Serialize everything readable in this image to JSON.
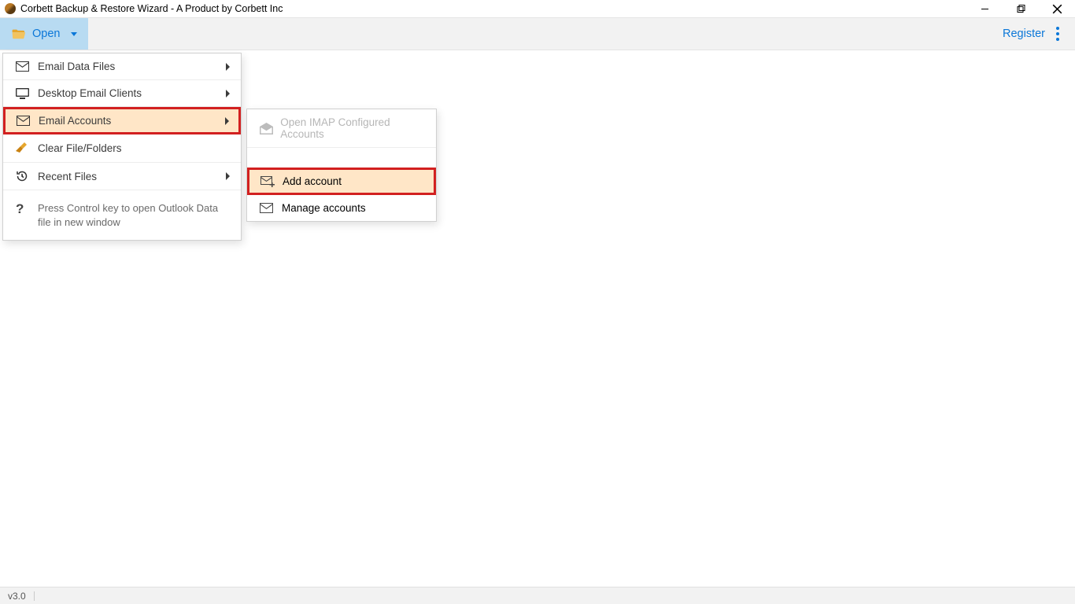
{
  "window": {
    "title": "Corbett Backup & Restore Wizard - A Product by Corbett Inc"
  },
  "toolbar": {
    "open_label": "Open",
    "register_label": "Register"
  },
  "menu": {
    "items": [
      {
        "label": "Email Data Files",
        "has_sub": true,
        "icon": "mail"
      },
      {
        "label": "Desktop Email Clients",
        "has_sub": true,
        "icon": "monitor"
      },
      {
        "label": "Email Accounts",
        "has_sub": true,
        "icon": "mail",
        "highlight": true
      },
      {
        "label": "Clear File/Folders",
        "has_sub": false,
        "icon": "broom"
      },
      {
        "label": "Recent Files",
        "has_sub": true,
        "icon": "history"
      }
    ],
    "hint": "Press Control key to open Outlook Data file in new window"
  },
  "submenu": {
    "items": [
      {
        "label": "Open IMAP Configured Accounts",
        "disabled": true,
        "icon": "open-mail"
      },
      {
        "label": "Add account",
        "highlight": true,
        "icon": "mail-plus"
      },
      {
        "label": "Manage accounts",
        "icon": "mail"
      }
    ]
  },
  "status": {
    "version": "v3.0"
  }
}
